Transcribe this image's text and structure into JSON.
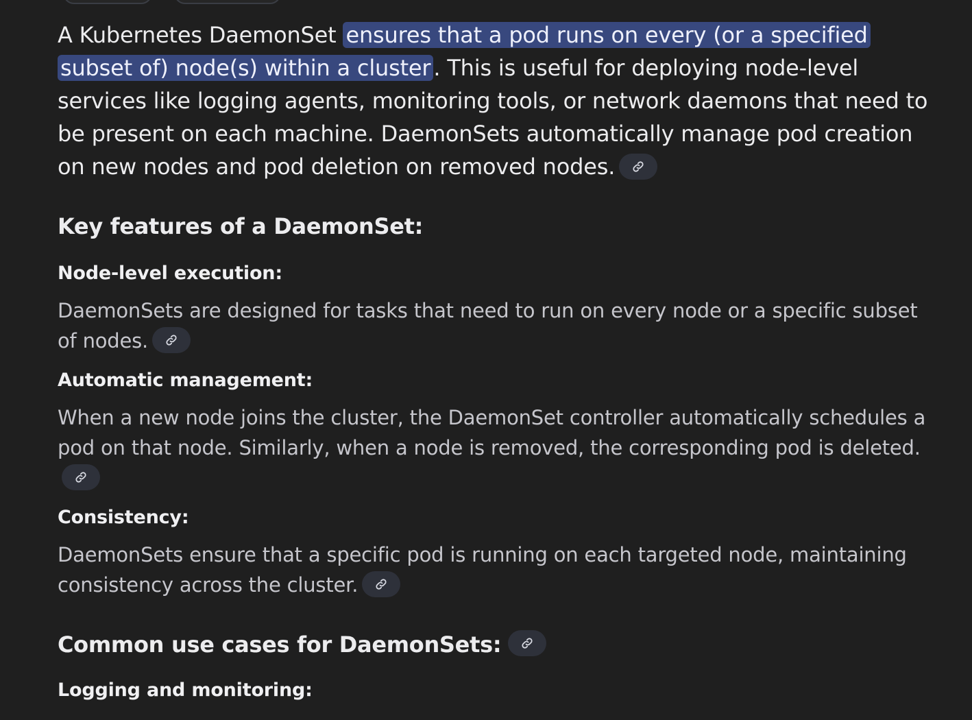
{
  "intro": {
    "lead": "A Kubernetes DaemonSet ",
    "highlight": "ensures that a pod runs on every (or a specified subset of) node(s) within a cluster",
    "rest": ". This is useful for deploying node-level services like logging agents, monitoring tools, or network daemons that need to be present on each machine. DaemonSets automatically manage pod creation on new nodes and pod deletion on removed nodes."
  },
  "key_features": {
    "heading": "Key features of a DaemonSet:",
    "items": [
      {
        "title": "Node-level execution:",
        "body": "DaemonSets are designed for tasks that need to run on every node or a specific subset of nodes."
      },
      {
        "title": "Automatic management:",
        "body": "When a new node joins the cluster, the DaemonSet controller automatically schedules a pod on that node. Similarly, when a node is removed, the corresponding pod is deleted."
      },
      {
        "title": "Consistency:",
        "body": "DaemonSets ensure that a specific pod is running on each targeted node, maintaining consistency across the cluster."
      }
    ]
  },
  "use_cases": {
    "heading": "Common use cases for DaemonSets:",
    "items": [
      {
        "title": "Logging and monitoring:"
      }
    ]
  },
  "icons": {
    "source_link": "link-icon"
  },
  "colors": {
    "background": "#1f1f1f",
    "highlight": "#38487e",
    "chip": "#2e313a"
  }
}
